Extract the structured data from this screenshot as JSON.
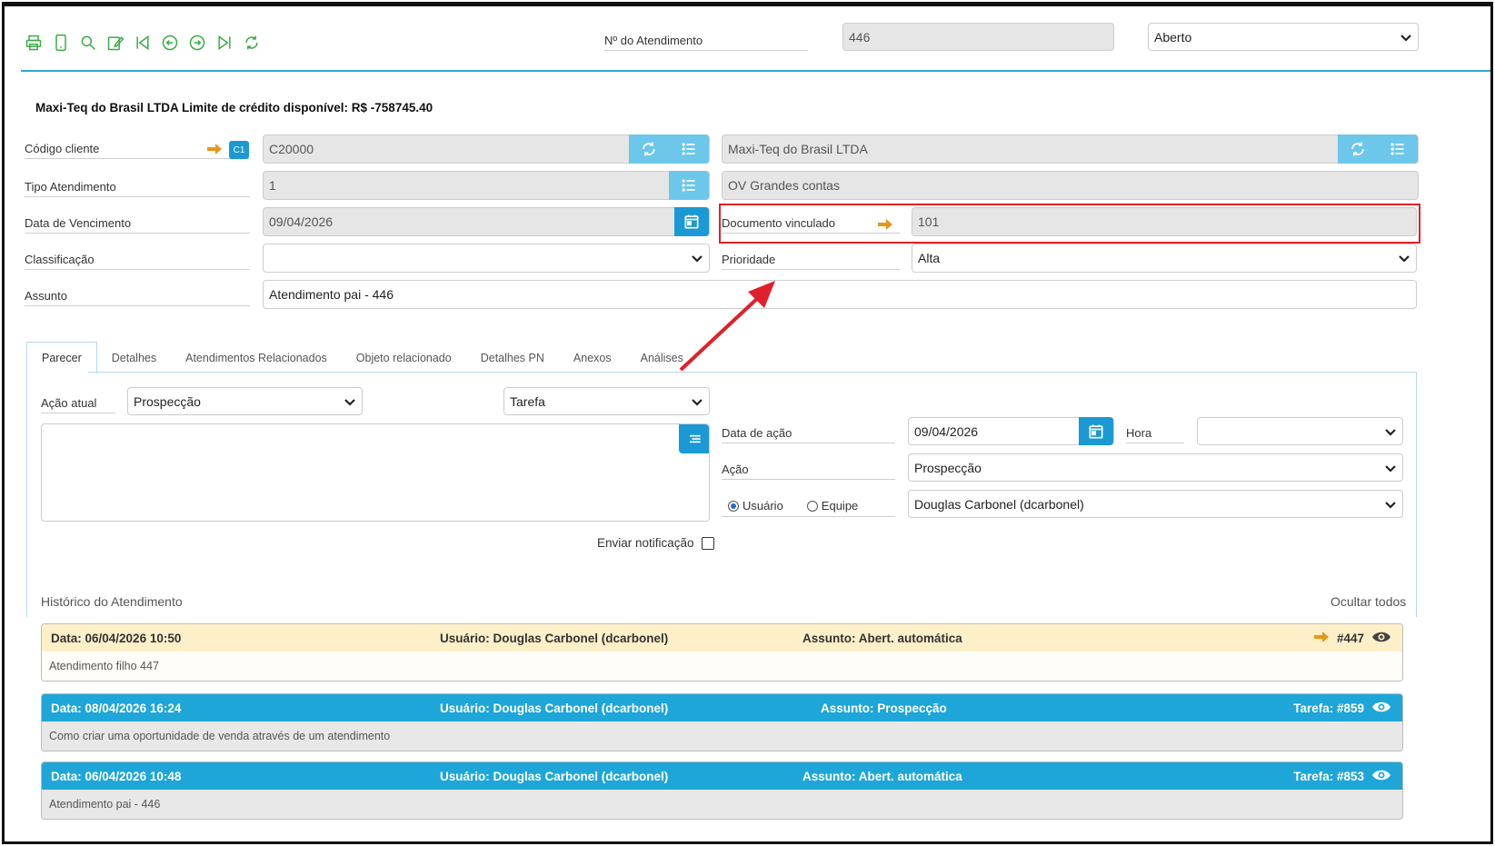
{
  "toolbar": {
    "icons": [
      "print-icon",
      "mobile-icon",
      "search-icon",
      "edit-icon",
      "first-icon",
      "prev-icon",
      "next-icon",
      "last-icon",
      "refresh-icon"
    ]
  },
  "header": {
    "atendimento_label": "Nº do Atendimento",
    "atendimento_value": "446",
    "status_value": "Aberto"
  },
  "credit_line": "Maxi-Teq do Brasil LTDA Limite de crédito disponível: R$ -758745.40",
  "form": {
    "codigo_cliente_label": "Código cliente",
    "codigo_cliente_badge": "C1",
    "codigo_cliente_value": "C20000",
    "cliente_nome_value": "Maxi-Teq do Brasil LTDA",
    "tipo_atendimento_label": "Tipo Atendimento",
    "tipo_atendimento_value": "1",
    "tipo_atendimento_desc": "OV Grandes contas",
    "data_vencimento_label": "Data de Vencimento",
    "data_vencimento_value": "09/04/2026",
    "documento_vinculado_label": "Documento vinculado",
    "documento_vinculado_value": "101",
    "classificacao_label": "Classificação",
    "classificacao_value": "",
    "prioridade_label": "Prioridade",
    "prioridade_value": "Alta",
    "assunto_label": "Assunto",
    "assunto_value": "Atendimento pai - 446"
  },
  "tabs": [
    {
      "label": "Parecer",
      "active": true
    },
    {
      "label": "Detalhes"
    },
    {
      "label": "Atendimentos Relacionados"
    },
    {
      "label": "Objeto relacionado"
    },
    {
      "label": "Detalhes PN"
    },
    {
      "label": "Anexos"
    },
    {
      "label": "Análises"
    }
  ],
  "parecer": {
    "acao_atual_label": "Ação atual",
    "acao_atual_value": "Prospecção",
    "tipo_value": "Tarefa",
    "data_acao_label": "Data de ação",
    "data_acao_value": "09/04/2026",
    "hora_label": "Hora",
    "hora_value": "",
    "acao_label": "Ação",
    "acao_value": "Prospecção",
    "radio_usuario": "Usuário",
    "radio_equipe": "Equipe",
    "responsavel_value": "Douglas Carbonel (dcarbonel)",
    "enviar_notificacao": "Enviar notificação"
  },
  "historico": {
    "title": "Histórico do Atendimento",
    "hide_all": "Ocultar todos",
    "items": [
      {
        "data": "Data: 06/04/2026 10:50",
        "usuario": "Usuário: Douglas Carbonel (dcarbonel)",
        "assunto": "Assunto: Abert. automática",
        "ref": "#447",
        "body": "Atendimento filho 447"
      },
      {
        "data": "Data: 08/04/2026 16:24",
        "usuario": "Usuário: Douglas Carbonel (dcarbonel)",
        "assunto": "Assunto: Prospecção",
        "ref": "Tarefa: #859",
        "body": "Como criar uma oportunidade de venda através de um atendimento"
      },
      {
        "data": "Data: 06/04/2026 10:48",
        "usuario": "Usuário: Douglas Carbonel (dcarbonel)",
        "assunto": "Assunto: Abert. automática",
        "ref": "Tarefa: #853",
        "body": "Atendimento pai - 446"
      }
    ]
  },
  "colors": {
    "accent": "#1b99d4",
    "light_accent": "#6cc7ea",
    "toolbar_green": "#3cab45",
    "orange_arrow": "#e8961a",
    "annotation_red": "#e0202a"
  }
}
